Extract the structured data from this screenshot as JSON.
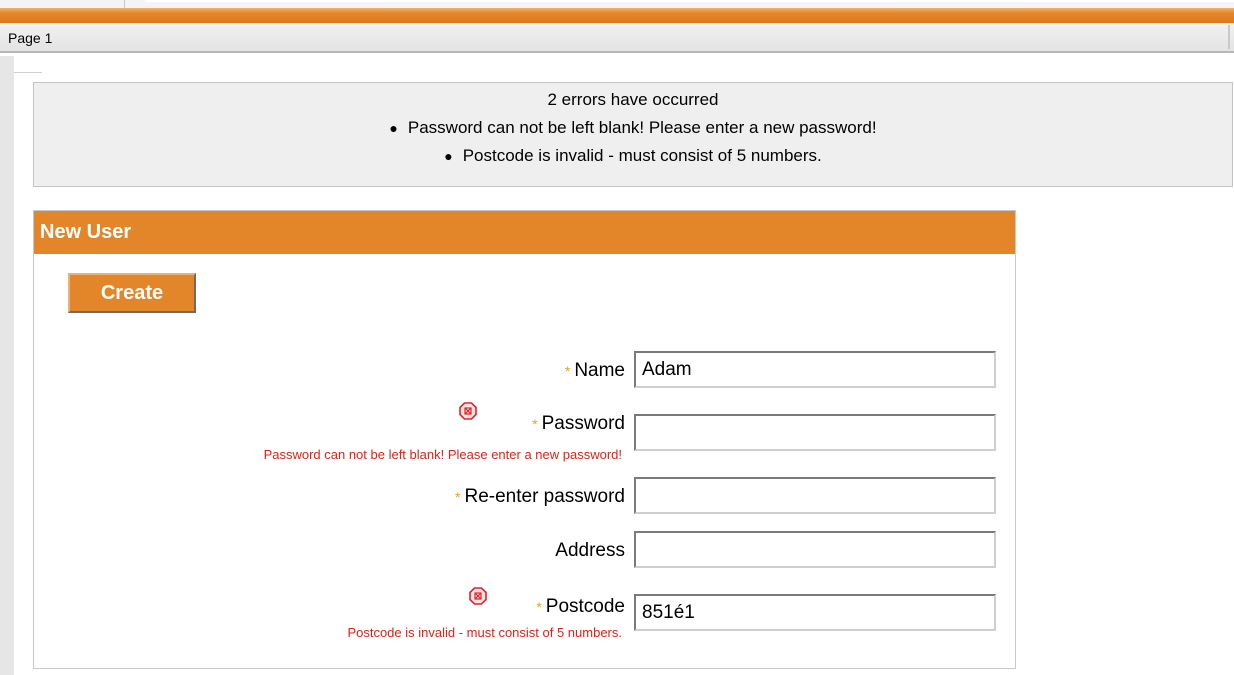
{
  "page": {
    "label": "Page 1"
  },
  "errors": {
    "summary": "2 errors have occurred",
    "items": [
      "Password can not be left blank! Please enter a new password!",
      "Postcode is invalid - must consist of 5 numbers."
    ]
  },
  "panel": {
    "title": "New User",
    "create_label": "Create"
  },
  "form": {
    "required_marker": "*",
    "name": {
      "label": "Name",
      "value": "Adam"
    },
    "password": {
      "label": "Password",
      "value": "",
      "error": "Password can not be left blank! Please enter a new password!"
    },
    "reenter": {
      "label": "Re-enter password",
      "value": ""
    },
    "address": {
      "label": "Address",
      "value": ""
    },
    "postcode": {
      "label": "Postcode",
      "value": "851é1",
      "error": "Postcode is invalid - must consist of 5 numbers."
    }
  },
  "colors": {
    "accent": "#e3862a",
    "error": "#e0221a",
    "required": "#e8a020"
  },
  "icons": {
    "error": "error-stop-icon"
  }
}
